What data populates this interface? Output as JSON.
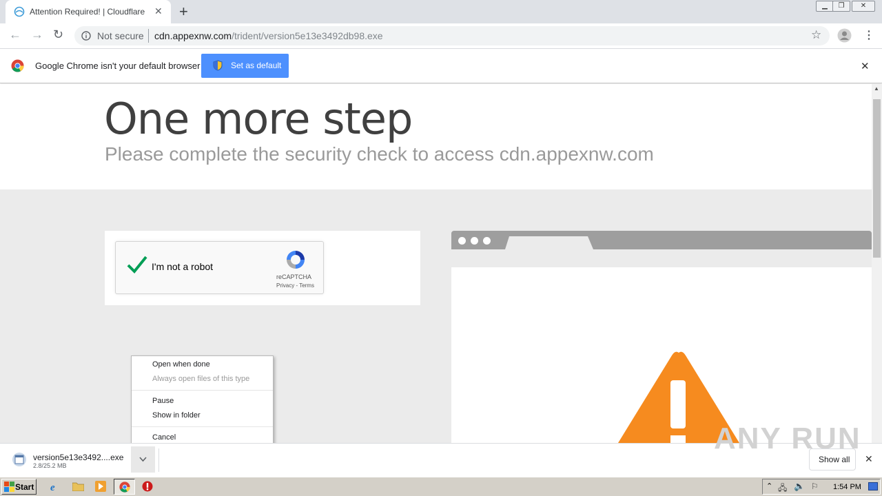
{
  "browser": {
    "tab_title": "Attention Required! | Cloudflare",
    "tab_close": "✕",
    "new_tab": "+",
    "security_label": "Not secure",
    "url_host": "cdn.appexnw.com",
    "url_path": "/trident/version5e13e3492db98.exe"
  },
  "infobar": {
    "message": "Google Chrome isn't your default browser",
    "button_label": "Set as default",
    "close": "✕"
  },
  "page": {
    "heading": "One more step",
    "subheading": "Please complete the security check to access cdn.appexnw.com"
  },
  "captcha": {
    "label": "I'm not a robot",
    "brand": "reCAPTCHA",
    "links": "Privacy - Terms",
    "checked": true
  },
  "context_menu": {
    "items": [
      {
        "label": "Open when done",
        "enabled": true
      },
      {
        "label": "Always open files of this type",
        "enabled": false
      },
      {
        "label": "Pause",
        "enabled": true
      },
      {
        "label": "Show in folder",
        "enabled": true
      },
      {
        "label": "Cancel",
        "enabled": true
      }
    ]
  },
  "download": {
    "filename": "version5e13e3492....exe",
    "progress": "2.8/25.2 MB",
    "show_all": "Show all",
    "close": "✕"
  },
  "watermark": "ANY RUN",
  "taskbar": {
    "start": "Start",
    "clock": "1:54 PM"
  },
  "colors": {
    "chrome_blue": "#4d90fe",
    "warning_orange": "#f68b1f",
    "check_green": "#009e55"
  },
  "icons": [
    "globe-icon",
    "info-icon",
    "star-icon",
    "account-icon",
    "menu-icon",
    "chrome-logo-icon",
    "shield-icon",
    "checkmark-icon",
    "recaptcha-logo-icon",
    "warning-icon",
    "file-icon",
    "chevron-down-icon"
  ]
}
